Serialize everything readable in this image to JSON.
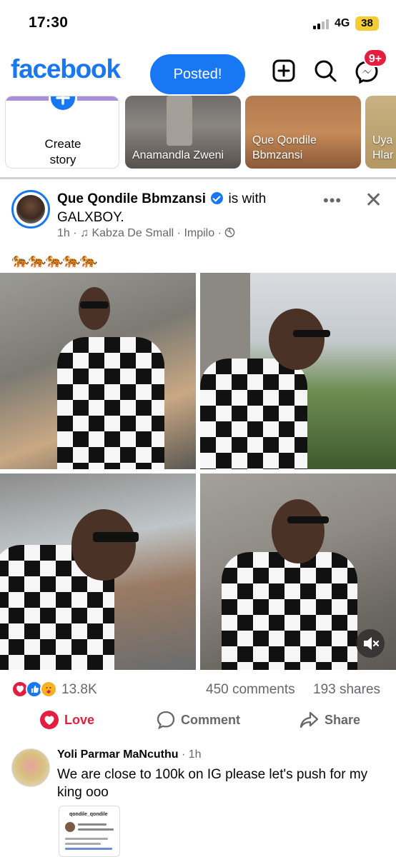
{
  "status": {
    "time": "17:30",
    "network": "4G",
    "battery": "38"
  },
  "header": {
    "logo": "facebook",
    "posted_label": "Posted!",
    "messenger_badge": "9+"
  },
  "stories": {
    "create_label_line1": "Create",
    "create_label_line2": "story",
    "items": [
      {
        "name": "Anamandla Zweni"
      },
      {
        "name": "Que Qondile Bbmzansi"
      },
      {
        "name": "Uya Hlar"
      }
    ]
  },
  "post": {
    "author": "Que Qondile Bbmzansi",
    "with_text": "is with",
    "tagged": "GALXBOY",
    "time": "1h",
    "music": "Kabza De Small",
    "song": "Impilo",
    "caption_emojis": "🐅🐅🐅🐅🐅",
    "reactions_count": "13.8K",
    "comments_count": "450 comments",
    "shares_count": "193 shares",
    "actions": {
      "love": "Love",
      "comment": "Comment",
      "share": "Share"
    }
  },
  "comment": {
    "author": "Yoli Parmar MaNcuthu",
    "time": "1h",
    "text": "We are close to 100k on IG please let's push for my king ooo",
    "image_username": "qondile_qondile"
  },
  "colors": {
    "brand": "#1877f2",
    "love": "#e41e3f",
    "muted": "#65676b"
  }
}
